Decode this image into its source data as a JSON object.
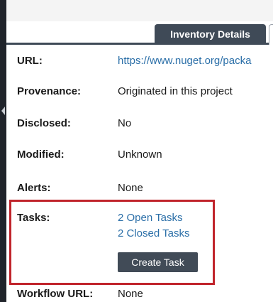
{
  "tabs": {
    "active_label": "Inventory Details"
  },
  "fields": {
    "url": {
      "label": "URL:",
      "value": "https://www.nuget.org/packa"
    },
    "provenance": {
      "label": "Provenance:",
      "value": "Originated in this project"
    },
    "disclosed": {
      "label": "Disclosed:",
      "value": "No"
    },
    "modified": {
      "label": "Modified:",
      "value": "Unknown"
    },
    "alerts": {
      "label": "Alerts:",
      "value": "None"
    },
    "tasks": {
      "label": "Tasks:",
      "open_tasks": "2 Open Tasks",
      "closed_tasks": "2 Closed Tasks",
      "create_button": "Create Task"
    },
    "workflow_url": {
      "label": "Workflow URL:",
      "value": "None"
    }
  },
  "colors": {
    "tab_active_bg": "#3f4a57",
    "link": "#2b6fa8",
    "highlight_border": "#c0242b",
    "button_bg": "#414b57"
  }
}
